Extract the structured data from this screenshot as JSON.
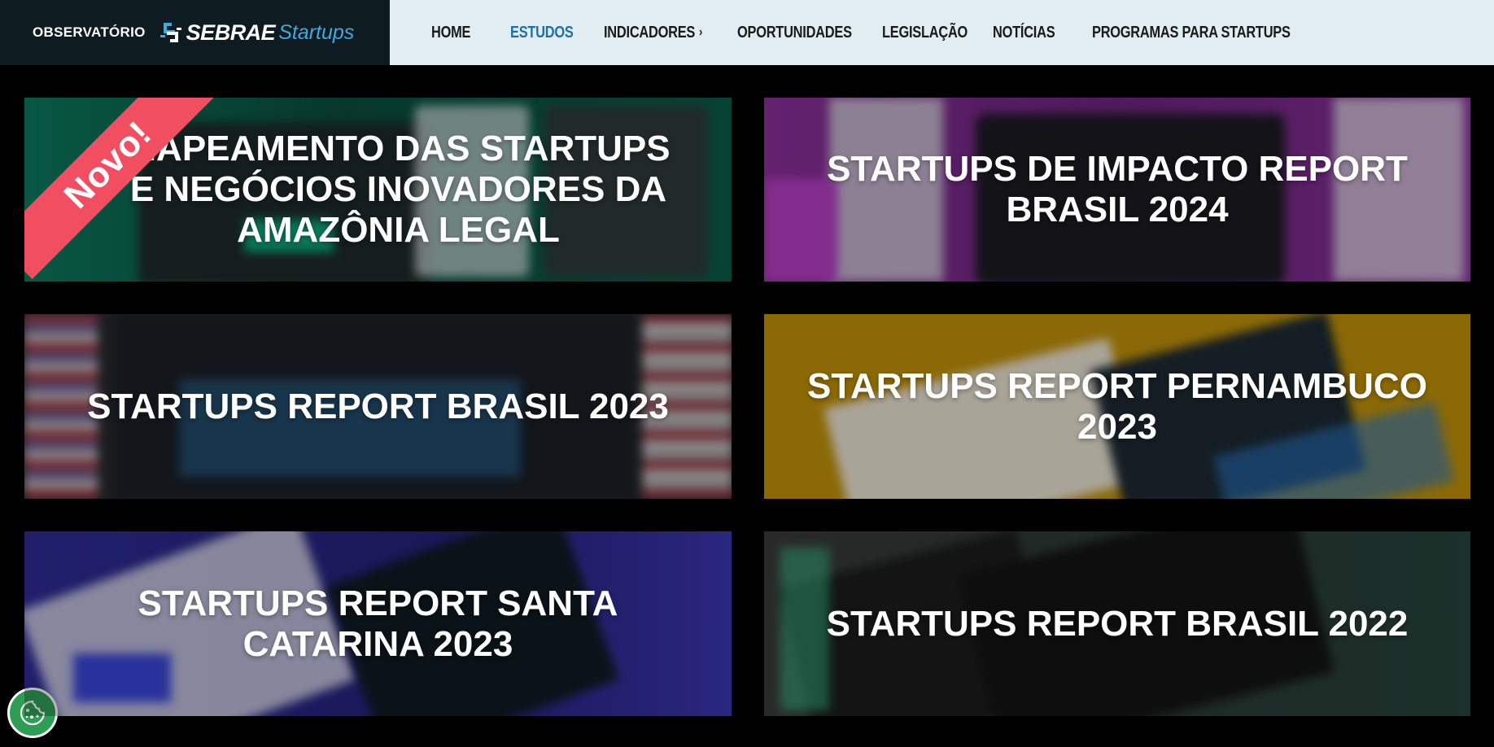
{
  "brand": {
    "observatorio": "OBSERVATÓRIO",
    "sebrae": "SEBRAE",
    "startups": "Startups"
  },
  "nav": {
    "items": [
      {
        "label": "HOME"
      },
      {
        "label": "ESTUDOS",
        "active": true
      },
      {
        "label": "INDICADORES",
        "icon": "chevron-right-icon"
      },
      {
        "label": "OPORTUNIDADES"
      },
      {
        "label": "LEGISLAÇÃO"
      },
      {
        "label": "NOTÍCIAS"
      },
      {
        "label": "PROGRAMAS PARA STARTUPS"
      }
    ]
  },
  "cards": [
    {
      "title": "MAPEAMENTO DAS STARTUPS E NEGÓCIOS INOVADORES DA AMAZÔNIA LEGAL",
      "badge": "Novo!",
      "color": "#0b5c4a"
    },
    {
      "title": "STARTUPS DE IMPACTO REPORT BRASIL 2024",
      "color": "#7a2a8a"
    },
    {
      "title": "STARTUPS REPORT BRASIL 2023",
      "color": "#2a2a2e"
    },
    {
      "title": "STARTUPS REPORT PERNAMBUCO 2023",
      "color": "#b88a08"
    },
    {
      "title": "STARTUPS REPORT SANTA CATARINA 2023",
      "color": "#2b2a8a"
    },
    {
      "title": "STARTUPS REPORT BRASIL 2022",
      "color": "#28443c"
    }
  ],
  "colors": {
    "brand_bg": "#0e1b20",
    "nav_bg": "#e1edf0",
    "nav_active": "#1d6fa8",
    "ribbon": "#f24e61",
    "cookie": "#2e9e55"
  },
  "cookie_button": {
    "icon": "cookie-icon"
  }
}
